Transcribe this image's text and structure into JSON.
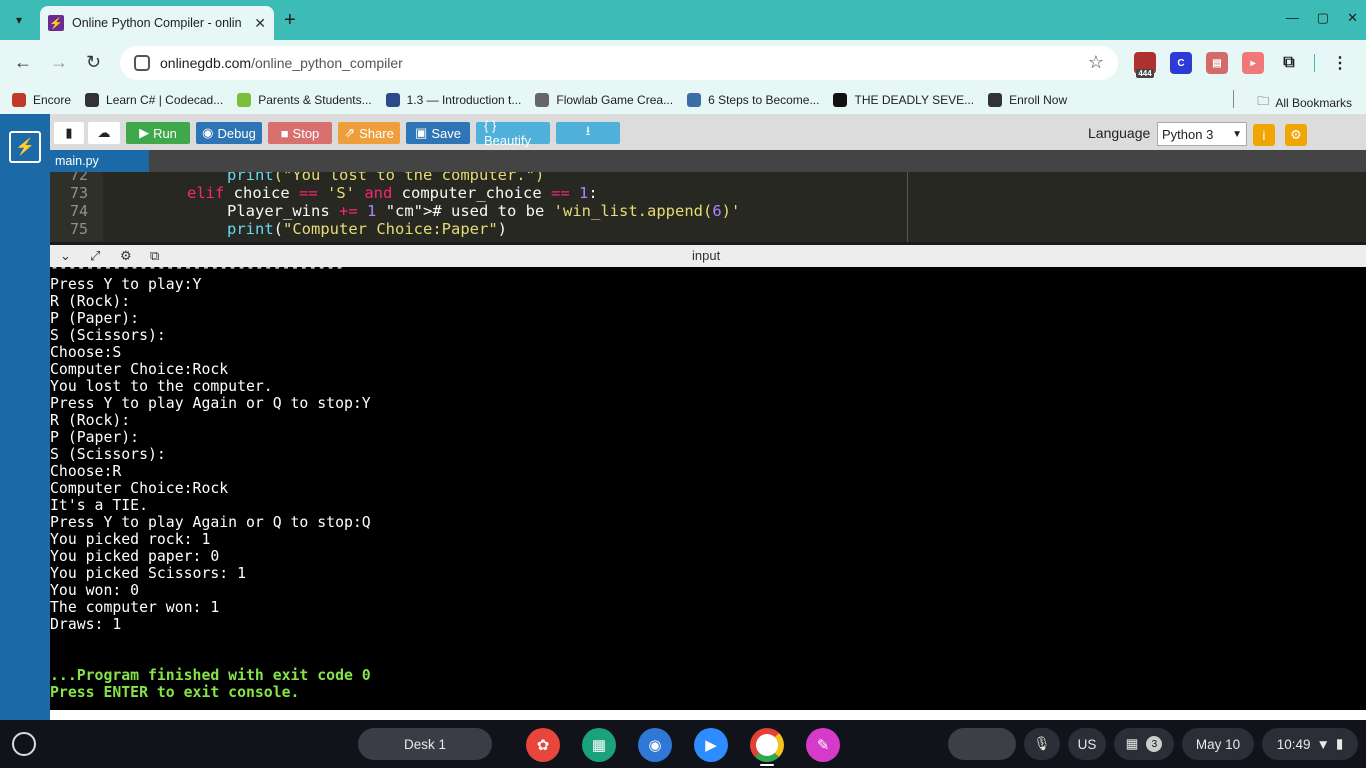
{
  "browser": {
    "tab_title": "Online Python Compiler - online",
    "url_domain": "onlinegdb.com",
    "url_path": "/online_python_compiler",
    "ext_badge": "444",
    "bookmarks": [
      {
        "label": "Encore",
        "icon": "play-icon",
        "color": "#c0392b"
      },
      {
        "label": "Learn C# | Codecad...",
        "icon": "codecademy-icon",
        "color": "#333333"
      },
      {
        "label": "Parents & Students...",
        "icon": "c-icon",
        "color": "#7bbf3a"
      },
      {
        "label": "1.3 — Introduction t...",
        "icon": "cpp-icon",
        "color": "#2a4a8a"
      },
      {
        "label": "Flowlab Game Crea...",
        "icon": "flowlab-icon",
        "color": "#666666"
      },
      {
        "label": "6 Steps to Become...",
        "icon": "binoculars-icon",
        "color": "#3a6ea8"
      },
      {
        "label": "THE DEADLY SEVE...",
        "icon": "letter-icon",
        "color": "#111111"
      },
      {
        "label": "Enroll Now",
        "icon": "globe-icon",
        "color": "#333333"
      }
    ],
    "all_bookmarks": "All Bookmarks"
  },
  "ide": {
    "buttons": {
      "run": "Run",
      "debug": "Debug",
      "stop": "Stop",
      "share": "Share",
      "save": "Save",
      "beautify": "{ } Beautify"
    },
    "language_label": "Language",
    "language_value": "Python 3",
    "file_tab": "main.py",
    "io_label": "input"
  },
  "code_lines": [
    {
      "num": "72",
      "code": "print(\"You lost to the computer.\")"
    },
    {
      "num": "73",
      "code": "elif choice == 'S' and computer_choice == 1:"
    },
    {
      "num": "74",
      "code": "Player_wins += 1 # used to be 'win_list.append(6)'"
    },
    {
      "num": "75",
      "code": "print(\"Computer Choice:Paper\")"
    }
  ],
  "console_lines": [
    "---------------------------------",
    "Press Y to play:Y",
    "R (Rock):",
    "P (Paper):",
    "S (Scissors):",
    "Choose:S",
    "Computer Choice:Rock",
    "You lost to the computer.",
    "Press Y to play Again or Q to stop:Y",
    "R (Rock):",
    "P (Paper):",
    "S (Scissors):",
    "Choose:R",
    "Computer Choice:Rock",
    "It's a TIE.",
    "Press Y to play Again or Q to stop:Q",
    "You picked rock: 1",
    "You picked paper: 0",
    "You picked Scissors: 1",
    "You won: 0",
    "The computer won: 1",
    "Draws: 1"
  ],
  "console_finish": [
    "...Program finished with exit code 0",
    "Press ENTER to exit console."
  ],
  "shelf": {
    "desk": "Desk 1",
    "keyboard": "US",
    "notif_count": "3",
    "date": "May 10",
    "time": "10:49"
  }
}
